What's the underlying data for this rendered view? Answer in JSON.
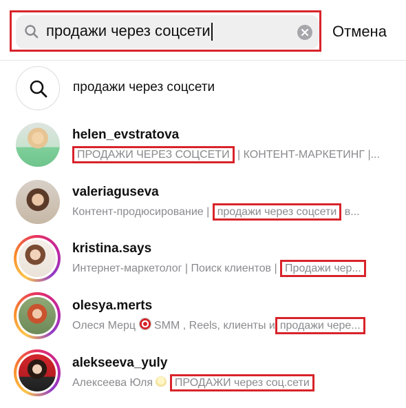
{
  "search": {
    "query": "продажи через соцсети",
    "cancel_label": "Отмена"
  },
  "suggestion": {
    "label": "продажи через соцсети"
  },
  "accounts": [
    {
      "username": "helen_evstratova",
      "bio_prefix": "",
      "bio_highlight": "ПРОДАЖИ ЧЕРЕЗ СОЦСЕТИ",
      "bio_suffix": " | КОНТЕНТ-МАРКЕТИНГ |...",
      "story_ring": false
    },
    {
      "username": "valeriaguseva",
      "bio_prefix": "Контент-продюсирование | ",
      "bio_highlight": "продажи через соцсети",
      "bio_suffix": " в...",
      "story_ring": false
    },
    {
      "username": "kristina.says",
      "bio_prefix": "Интернет-маркетолог | Поиск клиентов | ",
      "bio_highlight": "Продажи чер...",
      "bio_suffix": "",
      "story_ring": true
    },
    {
      "username": "olesya.merts",
      "bio_prefix": "Олеся Мерц ",
      "bio_emoji": "dart-emoji",
      "bio_middle": " SMM , Reels,  клиенты и",
      "bio_highlight": "продажи чере...",
      "bio_suffix": "",
      "story_ring": true
    },
    {
      "username": "alekseeva_yuly",
      "bio_prefix": "Алексеева Юля ",
      "bio_emoji": "lightbulb-emoji",
      "bio_highlight": "ПРОДАЖИ через соц.сети",
      "bio_suffix": "",
      "story_ring": true
    }
  ],
  "colors": {
    "highlight_box": "#d8232a",
    "secondary_text": "#8a8a8e",
    "search_bg": "#efeff0"
  }
}
